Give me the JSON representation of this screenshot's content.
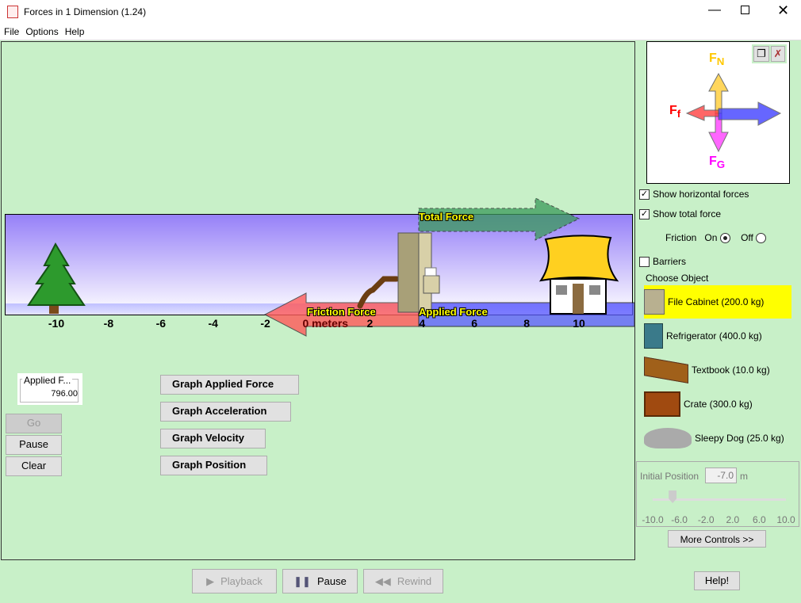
{
  "window": {
    "title": "Forces in 1 Dimension (1.24)"
  },
  "menu": [
    "File",
    "Options",
    "Help"
  ],
  "playground": {
    "ticks": [
      "-10",
      "-8",
      "-6",
      "-4",
      "-2",
      "0 meters",
      "2",
      "4",
      "6",
      "8",
      "10"
    ],
    "labels": {
      "total": "Total Force",
      "friction": "Friction Force",
      "applied": "Applied Force"
    }
  },
  "fbd": {
    "normal": "F",
    "normal_sub": "N",
    "friction": "F",
    "friction_sub": "f",
    "gravity": "F",
    "gravity_sub": "G"
  },
  "applied_force": {
    "label": "Applied F...",
    "value": "796.00"
  },
  "controls": {
    "go": "Go",
    "pause": "Pause",
    "clear": "Clear"
  },
  "graphs": [
    "Graph Applied Force",
    "Graph Acceleration",
    "Graph Velocity",
    "Graph Position"
  ],
  "options": {
    "show_horizontal": "Show horizontal forces",
    "show_horizontal_checked": true,
    "show_total": "Show total force",
    "show_total_checked": true,
    "friction": "Friction",
    "on": "On",
    "off": "Off",
    "friction_on": true,
    "barriers": "Barriers",
    "barriers_checked": false
  },
  "choose_object": "Choose Object",
  "objects": [
    {
      "label": "File Cabinet (200.0 kg)",
      "selected": true
    },
    {
      "label": "Refrigerator (400.0 kg)"
    },
    {
      "label": "Textbook (10.0 kg)"
    },
    {
      "label": "Crate (300.0 kg)"
    },
    {
      "label": "Sleepy Dog (25.0 kg)"
    }
  ],
  "position": {
    "label": "Initial Position",
    "value": "-7.0",
    "unit": "m",
    "slider_value": -7.0,
    "ticks": [
      "-10.0",
      "-6.0",
      "-2.0",
      "2.0",
      "6.0",
      "10.0"
    ]
  },
  "more_controls": "More Controls >>",
  "playback": {
    "playback": "Playback",
    "pause": "Pause",
    "rewind": "Rewind"
  },
  "help": "Help!",
  "colors": {
    "background": "#c8f0c8",
    "friction": "#ff6464",
    "applied": "#6464ff",
    "total": "#509060",
    "selected": "#ffff00"
  }
}
